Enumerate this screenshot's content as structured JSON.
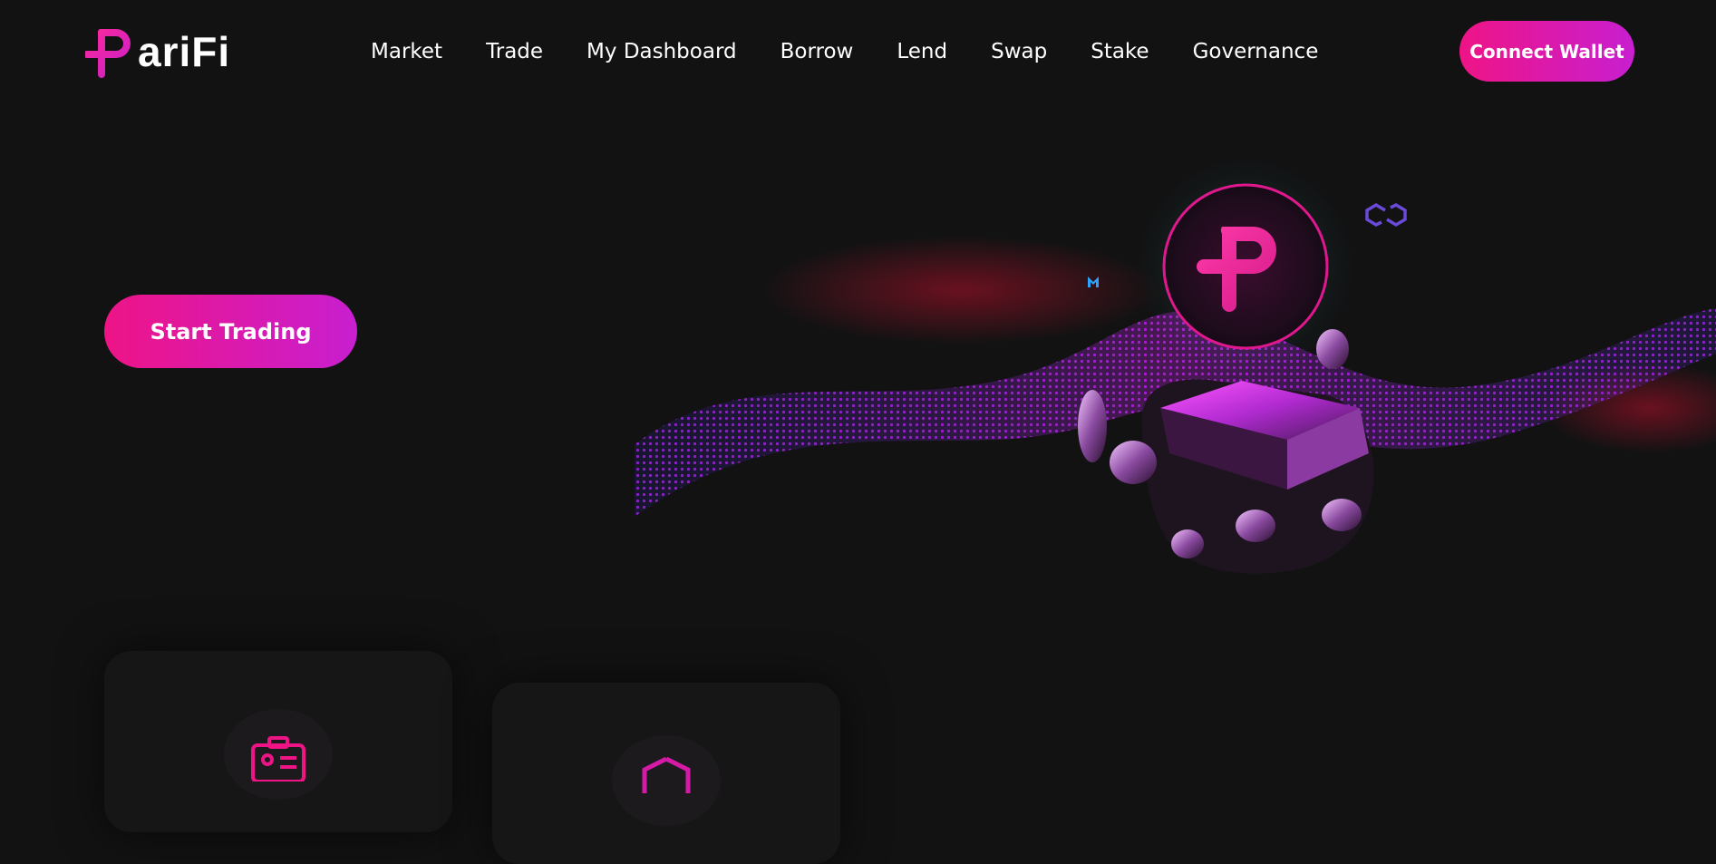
{
  "brand": {
    "logo_text": "ariFi",
    "accent_pink": "#ee1486",
    "accent_purple": "#c81fd0"
  },
  "nav": {
    "items": [
      {
        "label": "Market"
      },
      {
        "label": "Trade"
      },
      {
        "label": "My Dashboard"
      },
      {
        "label": "Borrow"
      },
      {
        "label": "Lend"
      },
      {
        "label": "Swap"
      },
      {
        "label": "Stake"
      },
      {
        "label": "Governance"
      }
    ]
  },
  "header": {
    "connect_wallet_label": "Connect Wallet"
  },
  "hero": {
    "start_trading_label": "Start Trading",
    "coin_icon": "parifi-p-icon",
    "floating_icons": [
      "m-token-icon",
      "polygon-icon"
    ]
  },
  "features": {
    "card_icons": [
      "id-card-icon",
      "hexagon-icon"
    ]
  }
}
